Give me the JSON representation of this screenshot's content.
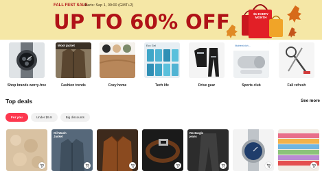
{
  "banner": {
    "sale_name": "FALL FEST SALE",
    "starts": "Starts: Sep 1, 09:00 (GMT+2)",
    "headline": "UP TO 60% OFF",
    "bag_text": "$1 EVERY MONTH",
    "colors": {
      "background": "#f5e7a6",
      "accent": "#b01217"
    }
  },
  "categories": [
    {
      "label": "Shop brands worry-free",
      "icon": "watch-image"
    },
    {
      "label": "Fashion trends",
      "icon": "jacket-image"
    },
    {
      "label": "Cozy home",
      "icon": "yarn-image"
    },
    {
      "label": "Tech life",
      "icon": "phones-image"
    },
    {
      "label": "Drive gear",
      "icon": "motorcycle-suit-image"
    },
    {
      "label": "Sports club",
      "icon": "foam-roller-image"
    },
    {
      "label": "Fall refresh",
      "icon": "mop-image"
    }
  ],
  "deals": {
    "title": "Top deals",
    "see_more": "See more",
    "tabs": [
      "For you",
      "Under $9.9",
      "Big discounts"
    ],
    "active_tab": "For you",
    "active_color": "#fd384f"
  },
  "thumb_text": {
    "cat_jacket": "Wool jacket",
    "cat_phones": "Ecc Gel",
    "cat_roller": "Nutrient-rich...",
    "product_jacket": "Oil Wash Jacket",
    "product_jeans": "Rectangle jeans"
  }
}
